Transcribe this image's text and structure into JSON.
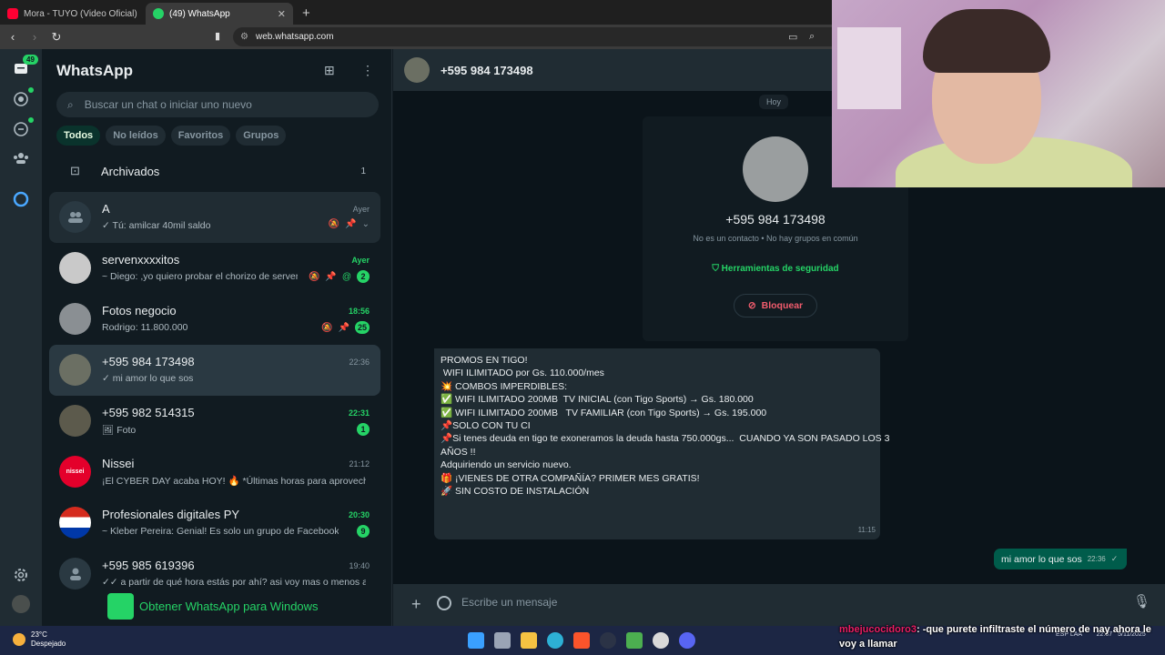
{
  "browser": {
    "tabs": [
      {
        "title": "Mora - TUYO (Video Oficial) - YouTube",
        "active": false
      },
      {
        "title": "(49) WhatsApp",
        "active": true
      }
    ],
    "new_tab": "+",
    "url": "web.whatsapp.com"
  },
  "rail": {
    "chats_badge": "49"
  },
  "sidebar": {
    "title": "WhatsApp",
    "search_placeholder": "Buscar un chat o iniciar uno nuevo",
    "filters": [
      "Todos",
      "No leídos",
      "Favoritos",
      "Grupos"
    ],
    "archived": {
      "label": "Archivados",
      "count": "1"
    },
    "chats": [
      {
        "name": "A",
        "time": "Ayer",
        "preview": "✓ Tú: amilcar 40mil saldo",
        "unread": "",
        "icons": "muted pinned chevron"
      },
      {
        "name": "servenxxxxitos",
        "time": "Ayer",
        "preview": "~ Diego: ,yo quiero probar el chorizo de serven",
        "unread": "2",
        "icons": "muted pinned mention"
      },
      {
        "name": "Fotos negocio",
        "time": "18:56",
        "preview": "Rodrigo: 11.800.000",
        "unread": "25",
        "icons": "muted pinned"
      },
      {
        "name": "+595 984 173498",
        "time": "22:36",
        "preview": "✓ mi amor lo que sos",
        "unread": "",
        "icons": ""
      },
      {
        "name": "+595 982 514315",
        "time": "22:31",
        "preview": "🖼 Foto",
        "unread": "1",
        "icons": ""
      },
      {
        "name": "Nissei",
        "time": "21:12",
        "preview": "¡El CYBER DAY acaba HOY! 🔥 *Últimas horas para aprovechar...",
        "unread": "",
        "icons": ""
      },
      {
        "name": "Profesionales digitales PY",
        "time": "20:30",
        "preview": "~ Kleber Pereira: Genial! Es solo un grupo de Facebook?",
        "unread": "9",
        "icons": ""
      },
      {
        "name": "+595 985 619396",
        "time": "19:40",
        "preview": "✓✓ a partir de qué hora estás por ahí? asi voy mas o menos a ...",
        "unread": "",
        "icons": ""
      }
    ],
    "get_windows": "Obtener WhatsApp para Windows"
  },
  "chat": {
    "header_name": "+595 984 173498",
    "day": "Hoy",
    "contact_card": {
      "number": "+595 984 173498",
      "subtitle": "No es un contacto • No hay grupos en común",
      "security": "Herramientas de seguridad",
      "block": "Bloquear"
    },
    "incoming": {
      "lines": [
        "PROMOS EN TIGO!",
        "",
        " WIFI ILIMITADO por Gs. 110.000/mes",
        "",
        "💥 COMBOS IMPERDIBLES:",
        "✅ WIFI ILIMITADO 200MB  TV INICIAL (con Tigo Sports) → Gs. 180.000",
        "✅ WIFI ILIMITADO 200MB   TV FAMILIAR (con Tigo Sports) → Gs. 195.000",
        "",
        "📌SOLO CON TU CI",
        "📌Si tenes deuda en tigo te exoneramos la deuda hasta 750.000gs...  CUANDO YA SON PASADO LOS 3",
        "AÑOS !!",
        "Adquiriendo un servicio nuevo.",
        "🎁 ¡VIENES DE OTRA COMPAÑÍA? PRIMER MES GRATIS!",
        "🚀 SIN COSTO DE INSTALACIÓN"
      ],
      "time": "11:15"
    },
    "outgoing": {
      "text": "mi amor lo que sos",
      "time": "22:36"
    },
    "composer_placeholder": "Escribe un mensaje"
  },
  "taskbar": {
    "temp": "23°C",
    "weather": "Despejado",
    "tray_lang": "ESP LAA",
    "tray_time": "22:37",
    "tray_date": "5/11/2025"
  },
  "stream_chat": {
    "user": "mbejucocidoro3",
    "message": ": -que purete infiltraste el número de nay ahora le voy a llamar"
  },
  "colors": {
    "accent": "#25d366",
    "panel": "#202c33",
    "bg": "#111b21",
    "outgoing": "#005c4b"
  }
}
